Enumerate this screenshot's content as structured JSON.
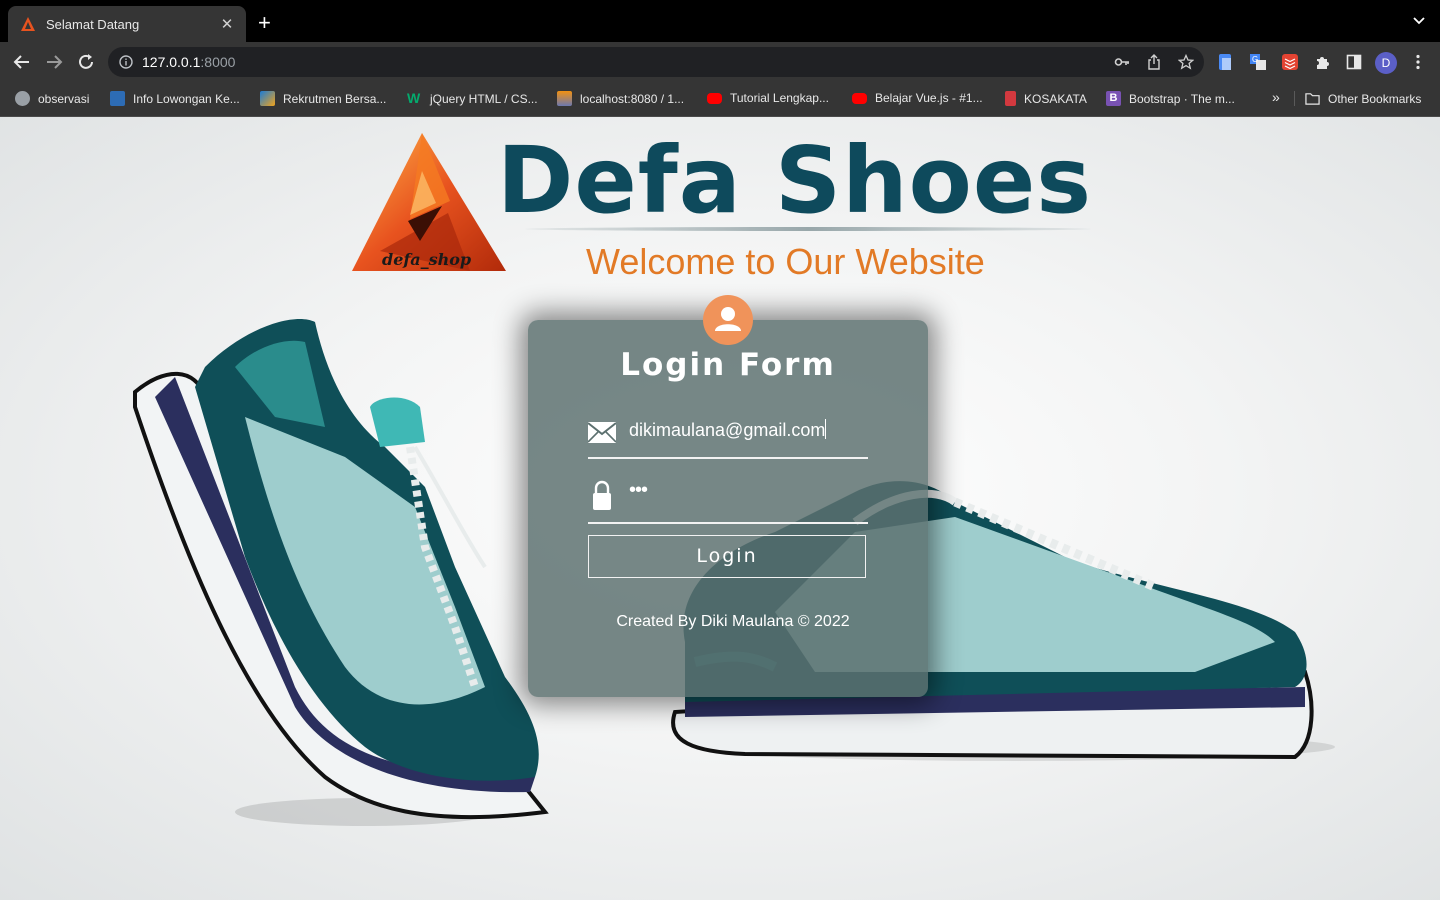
{
  "browser": {
    "tab_title": "Selamat Datang",
    "tab_close": "✕",
    "new_tab": "+",
    "url_host": "127.0.0.1",
    "url_port": ":8000",
    "profile_initial": "D",
    "bookmarks": [
      {
        "label": "observasi",
        "icon": "globe-icon",
        "color": "#9aa0a6"
      },
      {
        "label": "Info Lowongan Ke...",
        "icon": "ok-icon",
        "color": "#2d6cb5"
      },
      {
        "label": "Rekrutmen Bersa...",
        "icon": "rekrutmen-icon",
        "color": "#1c7cd6"
      },
      {
        "label": "jQuery HTML / CS...",
        "icon": "w3schools-icon",
        "color": "#04aa6d"
      },
      {
        "label": "localhost:8080 / 1...",
        "icon": "phpmyadmin-icon",
        "color": "#f29111"
      },
      {
        "label": "Tutorial Lengkap...",
        "icon": "youtube-icon",
        "color": "#ff0000"
      },
      {
        "label": "Belajar Vue.js - #1...",
        "icon": "youtube-icon",
        "color": "#ff0000"
      },
      {
        "label": "KOSAKATA",
        "icon": "book-icon",
        "color": "#d3393f"
      },
      {
        "label": "Bootstrap · The m...",
        "icon": "bootstrap-icon",
        "color": "#7952b3"
      }
    ],
    "overflow_chevron": "»",
    "other_bookmarks": "Other Bookmarks"
  },
  "header": {
    "logo_caption": "defa_shop",
    "brand": "Defa Shoes",
    "tagline": "Welcome to Our Website",
    "brand_color": "#0e4a5c",
    "tagline_color": "#e27a26"
  },
  "login": {
    "title": "Login Form",
    "email_value": "dikimaulana@gmail.com",
    "password_mask": "•••",
    "button_label": "Login",
    "credit": "Created By Diki Maulana © 2022",
    "avatar_color": "#f0935a"
  }
}
